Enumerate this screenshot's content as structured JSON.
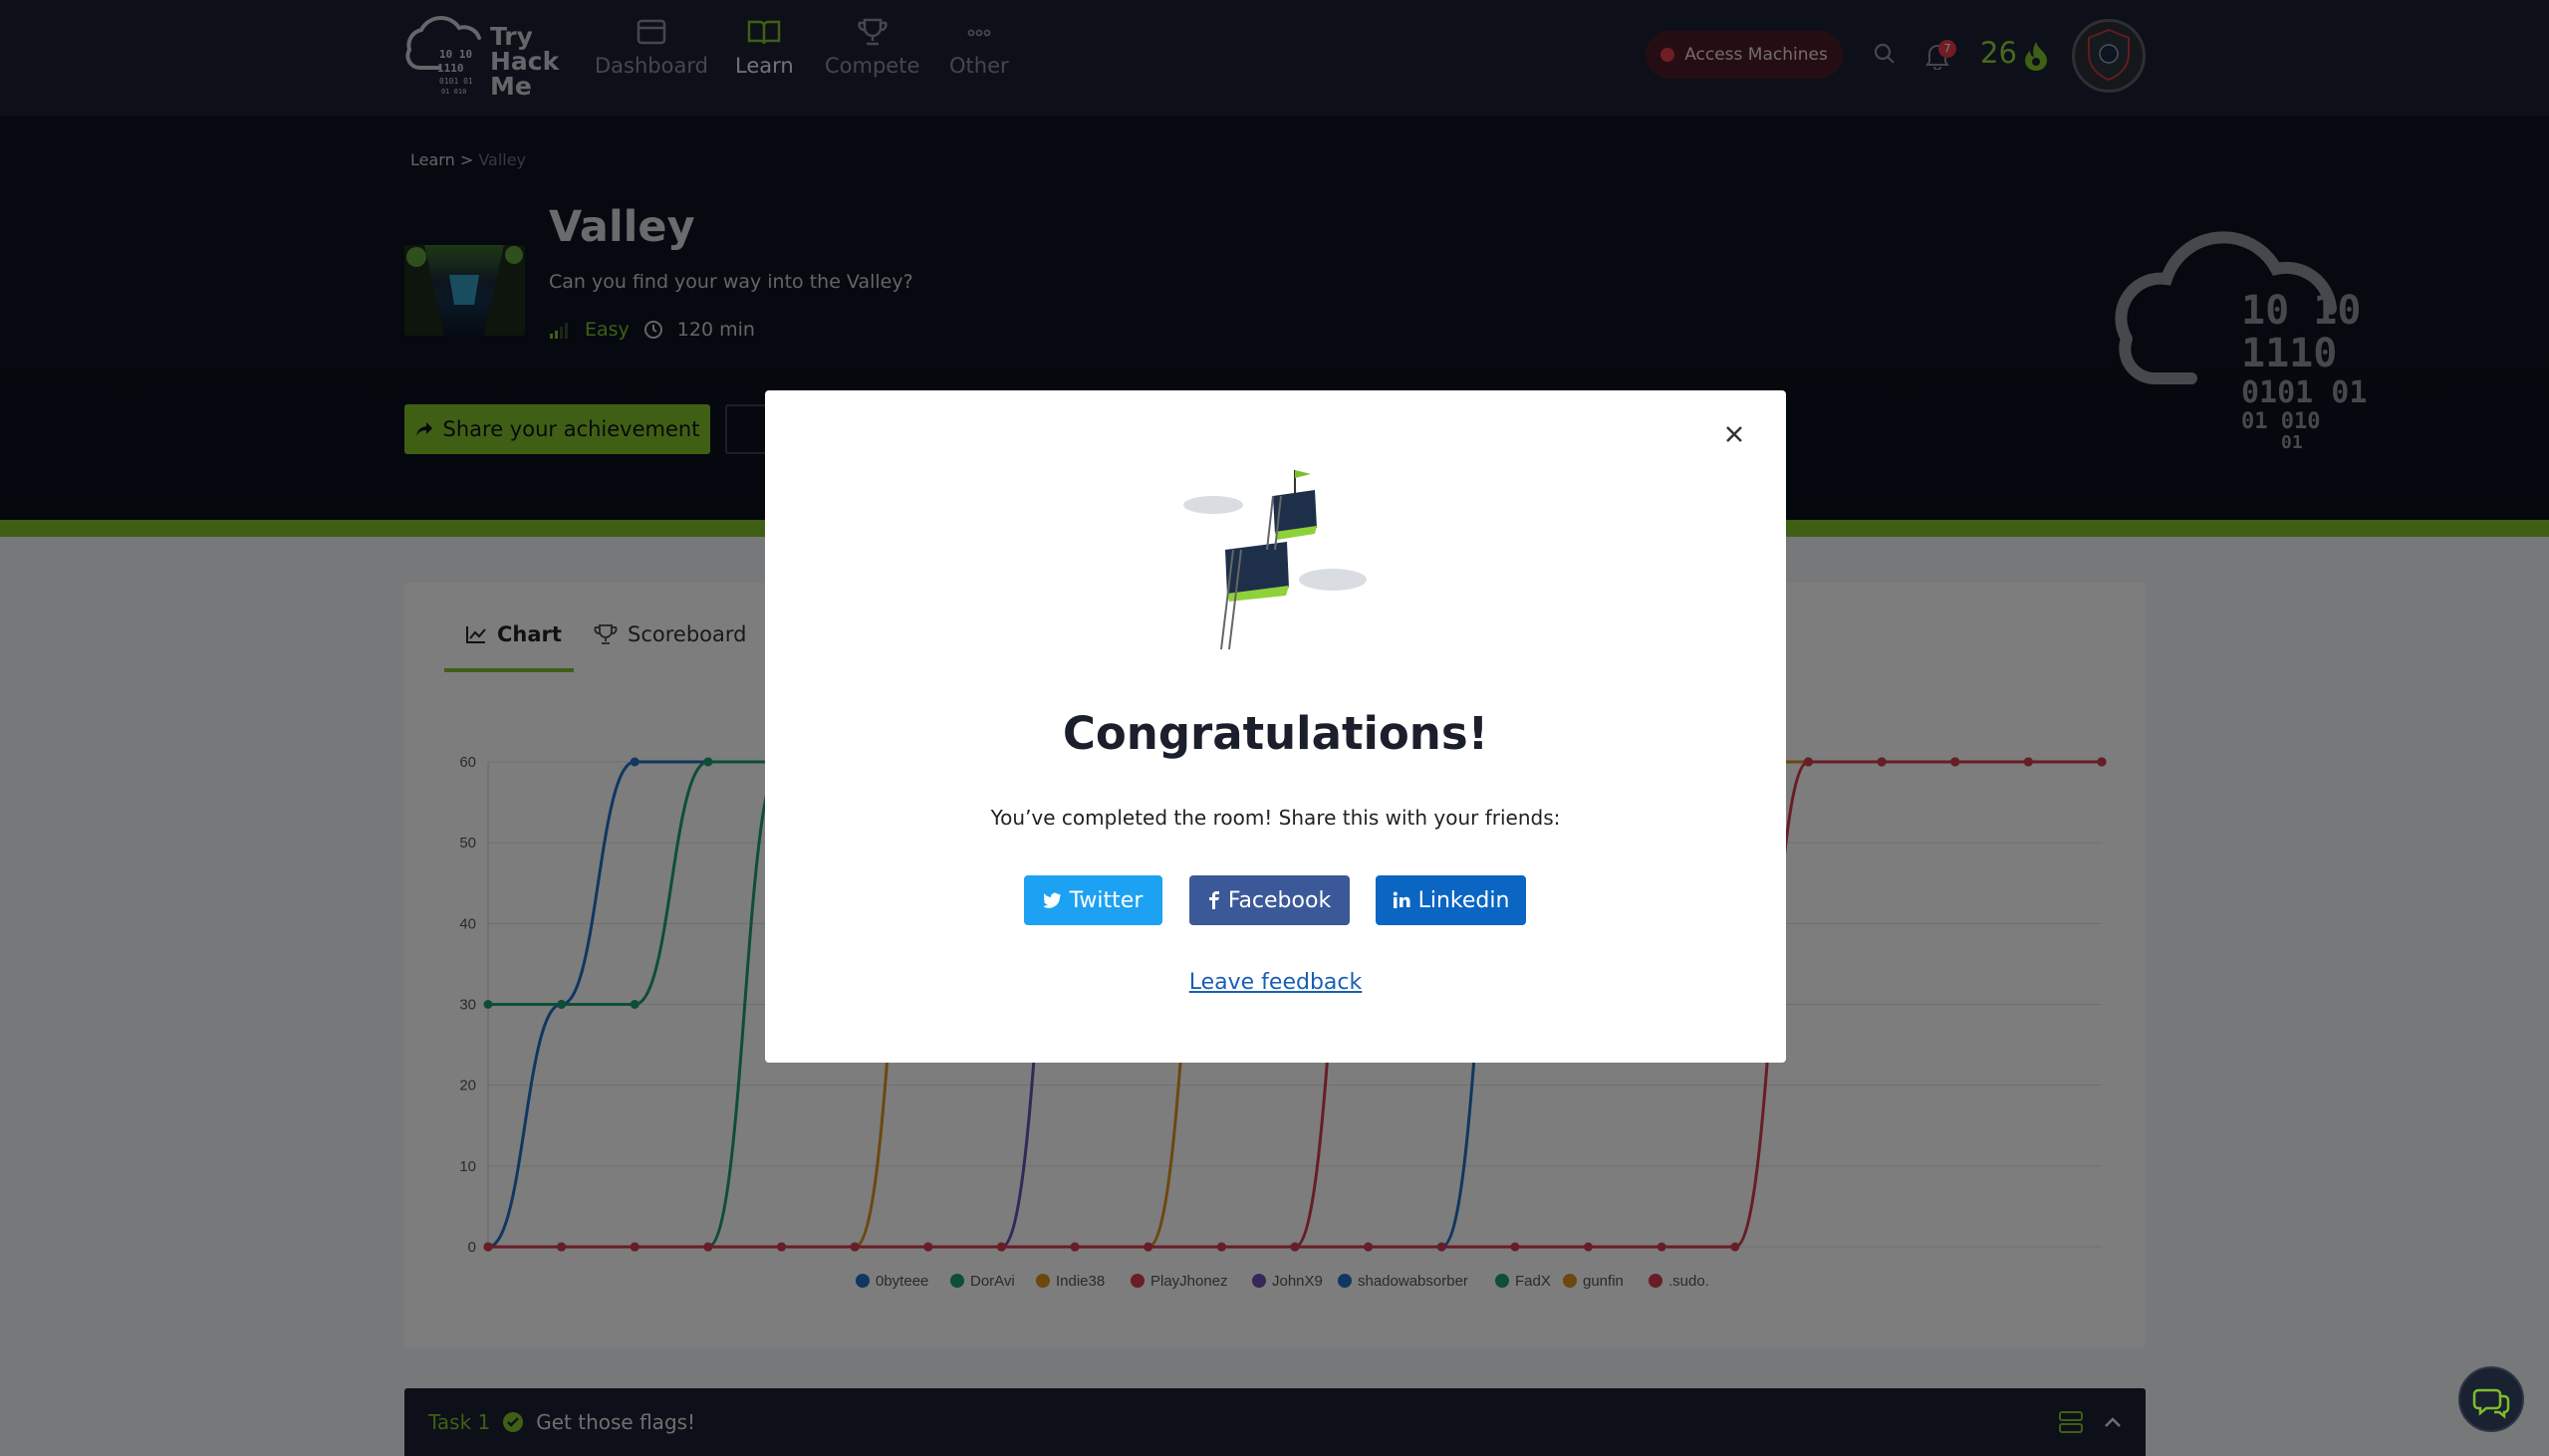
{
  "logo": {
    "line1": "Try",
    "line2": "Hack",
    "line3": "Me"
  },
  "nav": {
    "items": [
      {
        "label": "Dashboard",
        "icon": "dashboard-icon"
      },
      {
        "label": "Learn",
        "icon": "book-icon",
        "active": true
      },
      {
        "label": "Compete",
        "icon": "trophy-icon"
      },
      {
        "label": "Other",
        "icon": "dots-icon"
      }
    ],
    "access_machines": "Access Machines",
    "notifications_count": "7",
    "streak": "26"
  },
  "breadcrumb": {
    "parent": "Learn",
    "separator": ">",
    "current": "Valley"
  },
  "room": {
    "title": "Valley",
    "subtitle": "Can you find your way into the Valley?",
    "difficulty": "Easy",
    "duration": "120 min",
    "share_label": "Share your achievement"
  },
  "tabs": {
    "chart": "Chart",
    "scoreboard": "Scoreboard"
  },
  "chart_data": {
    "type": "line",
    "ylim": [
      0,
      60
    ],
    "yticks": [
      "0",
      "10",
      "20",
      "30",
      "40",
      "50",
      "60"
    ],
    "x": [
      0,
      1,
      2,
      3,
      4,
      5,
      6,
      7,
      8,
      9,
      10,
      11,
      12,
      13,
      14,
      15,
      16,
      17,
      18,
      19,
      20,
      21,
      22
    ],
    "series": [
      {
        "name": "0byteee",
        "color": "#1f6fc0",
        "values": [
          0,
          30,
          60,
          60,
          60,
          60,
          60,
          60,
          60,
          60,
          60,
          60,
          60,
          60,
          60,
          60,
          60,
          60,
          60,
          60,
          60,
          60,
          60
        ]
      },
      {
        "name": "DorAvi",
        "color": "#1c9c6b",
        "values": [
          30,
          30,
          30,
          60,
          60,
          60,
          60,
          60,
          60,
          60,
          60,
          60,
          60,
          60,
          60,
          60,
          60,
          60,
          60,
          60,
          60,
          60,
          60
        ]
      },
      {
        "name": "Indie38",
        "color": "#d9901f",
        "values": [
          0,
          0,
          0,
          0,
          0,
          0,
          60,
          60,
          60,
          60,
          60,
          60,
          60,
          60,
          60,
          60,
          60,
          60,
          60,
          60,
          60,
          60,
          60
        ]
      },
      {
        "name": "PlayJhonez",
        "color": "#d03a4e",
        "values": [
          0,
          0,
          0,
          0,
          0,
          0,
          0,
          0,
          0,
          0,
          0,
          0,
          60,
          60,
          60,
          60,
          60,
          60,
          60,
          60,
          60,
          60,
          60
        ]
      },
      {
        "name": "JohnX9",
        "color": "#6a4fb0",
        "values": [
          0,
          0,
          0,
          0,
          0,
          0,
          0,
          0,
          60,
          60,
          60,
          60,
          60,
          60,
          60,
          60,
          60,
          60,
          60,
          60,
          60,
          60,
          60
        ]
      },
      {
        "name": "shadowabsorber",
        "color": "#1f6fc0",
        "values": [
          0,
          0,
          0,
          0,
          0,
          0,
          0,
          0,
          0,
          0,
          0,
          0,
          0,
          0,
          60,
          60,
          60,
          60,
          60,
          60,
          60,
          60,
          60
        ]
      },
      {
        "name": "FadX",
        "color": "#1c9c6b",
        "values": [
          0,
          0,
          0,
          0,
          60,
          60,
          60,
          60,
          60,
          60,
          60,
          60,
          60,
          60,
          60,
          60,
          60,
          60,
          60,
          60,
          60,
          60,
          60
        ]
      },
      {
        "name": "gunfin",
        "color": "#d9901f",
        "values": [
          0,
          0,
          0,
          0,
          0,
          0,
          0,
          0,
          0,
          0,
          60,
          60,
          60,
          60,
          60,
          60,
          60,
          60,
          60,
          60,
          60,
          60,
          60
        ]
      },
      {
        "name": ".sudo.",
        "color": "#d03a4e",
        "values": [
          0,
          0,
          0,
          0,
          0,
          0,
          0,
          0,
          0,
          0,
          0,
          0,
          0,
          0,
          0,
          0,
          0,
          0,
          60,
          60,
          60,
          60,
          60
        ]
      }
    ]
  },
  "modal": {
    "title": "Congratulations!",
    "text": "You’ve completed the room! Share this with your friends:",
    "twitter": "Twitter",
    "facebook": "Facebook",
    "linkedin": "Linkedin",
    "feedback": "Leave feedback"
  },
  "task": {
    "number": "Task 1",
    "title": "Get those flags!"
  }
}
